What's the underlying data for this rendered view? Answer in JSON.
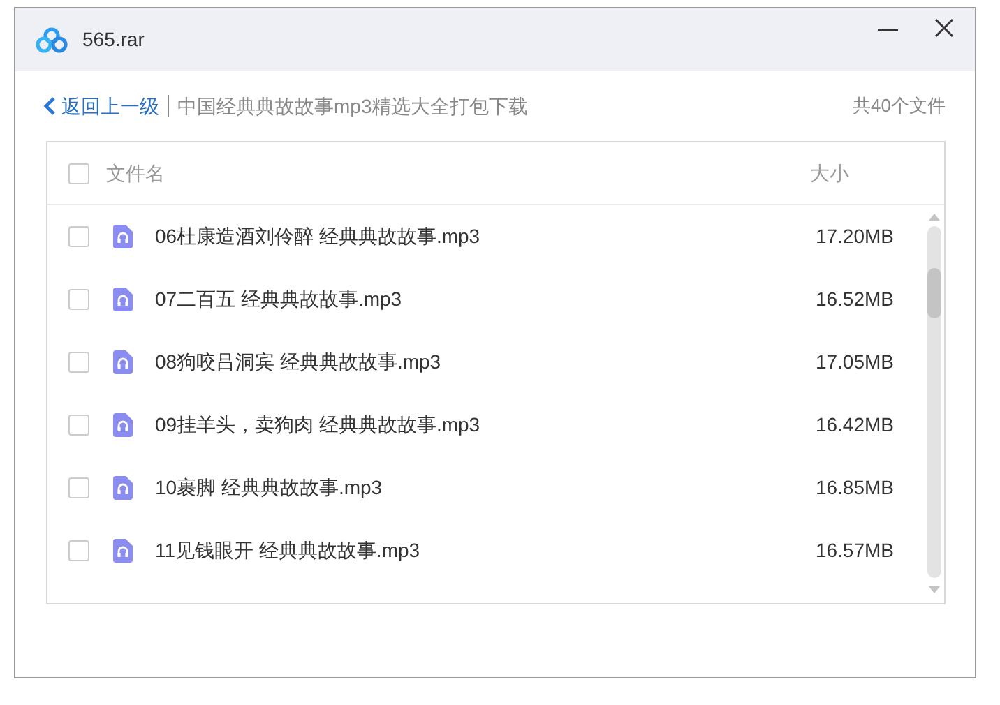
{
  "window": {
    "title": "565.rar"
  },
  "breadcrumb": {
    "back": "返回上一级",
    "path": "中国经典典故故事mp3精选大全打包下载",
    "count": "共40个文件"
  },
  "table": {
    "select_all": {
      "checked": false
    },
    "columns": [
      "文件名",
      "大小"
    ],
    "rows": [
      {
        "name": "06杜康造酒刘伶醉 经典典故故事.mp3",
        "size": "17.20MB",
        "checked": false
      },
      {
        "name": "07二百五 经典典故故事.mp3",
        "size": "16.52MB",
        "checked": false
      },
      {
        "name": "08狗咬吕洞宾 经典典故故事.mp3",
        "size": "17.05MB",
        "checked": false
      },
      {
        "name": "09挂羊头，卖狗肉 经典典故故事.mp3",
        "size": "16.42MB",
        "checked": false
      },
      {
        "name": "10裹脚 经典典故故事.mp3",
        "size": "16.85MB",
        "checked": false
      },
      {
        "name": "11见钱眼开 经典典故故事.mp3",
        "size": "16.57MB",
        "checked": false
      }
    ]
  }
}
